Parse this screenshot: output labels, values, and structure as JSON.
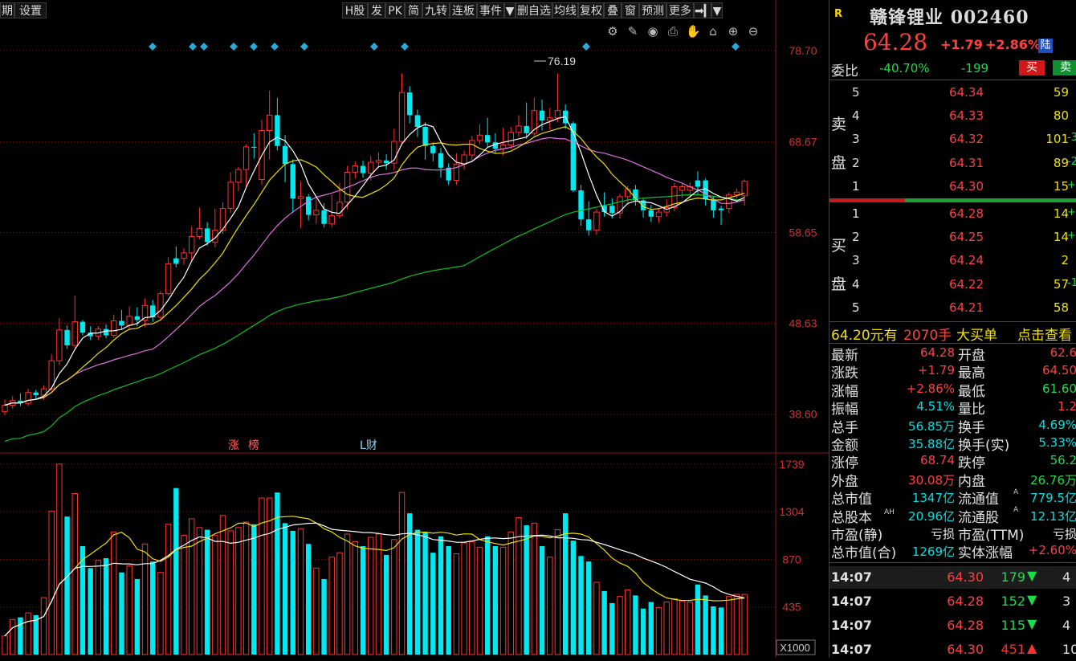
{
  "toolbar": {
    "left_items": [
      "期",
      "设置"
    ],
    "right_items": [
      "H股",
      "发",
      "PK",
      "简",
      "九转",
      "连板",
      "事件",
      "▼",
      "删自选",
      "均线",
      "复权",
      "叠",
      "窗",
      "预测",
      "更多",
      "➡▎",
      "▼"
    ],
    "icons": [
      "settings-icon",
      "pen-icon",
      "eye-icon",
      "print-icon",
      "hand-icon",
      "lock-icon",
      "zoom-in-icon",
      "zoom-out-icon"
    ]
  },
  "price_axis": [
    "78.70",
    "68.67",
    "58.65",
    "48.63",
    "38.60"
  ],
  "volume_axis": [
    "1739",
    "1304",
    "870",
    "435",
    "X1000"
  ],
  "high_label": "76.19",
  "markers": {
    "zhang": "涨",
    "bang": "榜",
    "l_cai": "L财"
  },
  "colors": {
    "up": "#ff3030",
    "down": "#00e8f0",
    "ma5": "#ffffff",
    "ma10": "#f0e000",
    "ma20": "#e070e0",
    "ma60": "#10c020",
    "grid": "#7a1010",
    "diamond": "#2aa8d8"
  },
  "stock": {
    "badge": "R",
    "name": "赣锋锂业",
    "code": "002460",
    "price": "64.28",
    "change": "+1.79",
    "change_pct": "+2.86%",
    "exchange": "陆"
  },
  "ratio": {
    "label": "委比",
    "pct": "-40.70%",
    "diff": "-199",
    "buy_btn": "买",
    "sell_btn": "卖"
  },
  "sell_side_label": [
    "卖",
    "盘"
  ],
  "buy_side_label": [
    "买",
    "盘"
  ],
  "sell_levels": [
    {
      "n": "5",
      "price": "64.34",
      "vol": "59",
      "chg": ""
    },
    {
      "n": "4",
      "price": "64.33",
      "vol": "80",
      "chg": ""
    },
    {
      "n": "3",
      "price": "64.32",
      "vol": "101",
      "chg": "-3"
    },
    {
      "n": "2",
      "price": "64.31",
      "vol": "89",
      "chg": "-2"
    },
    {
      "n": "1",
      "price": "64.30",
      "vol": "15",
      "chg": "+"
    }
  ],
  "buy_levels": [
    {
      "n": "1",
      "price": "64.28",
      "vol": "14",
      "chg": "+"
    },
    {
      "n": "2",
      "price": "64.25",
      "vol": "14",
      "chg": "+"
    },
    {
      "n": "3",
      "price": "64.24",
      "vol": "2",
      "chg": ""
    },
    {
      "n": "4",
      "price": "64.22",
      "vol": "57",
      "chg": "-1"
    },
    {
      "n": "5",
      "price": "64.21",
      "vol": "58",
      "chg": ""
    }
  ],
  "big_order": {
    "price": "64.20元有",
    "qty": "2070手",
    "label": "大买单",
    "link": "点击查看"
  },
  "stats": [
    {
      "l1": "最新",
      "v1": "64.28",
      "c1": "red",
      "l2": "开盘",
      "v2": "62.6",
      "c2": "red"
    },
    {
      "l1": "涨跌",
      "v1": "+1.79",
      "c1": "red",
      "l2": "最高",
      "v2": "64.50",
      "c2": "red"
    },
    {
      "l1": "涨幅",
      "v1": "+2.86%",
      "c1": "red",
      "l2": "最低",
      "v2": "61.60",
      "c2": "green"
    },
    {
      "l1": "振幅",
      "v1": "4.51%",
      "c1": "cyan",
      "l2": "量比",
      "v2": "1.2",
      "c2": "red"
    },
    {
      "l1": "总手",
      "v1": "56.85万",
      "c1": "cyan",
      "l2": "换手",
      "v2": "4.69%",
      "c2": "cyan"
    },
    {
      "l1": "金额",
      "v1": "35.88亿",
      "c1": "cyan",
      "l2": "换手(实)",
      "v2": "5.33%",
      "c2": "cyan"
    },
    {
      "l1": "涨停",
      "v1": "68.74",
      "c1": "red",
      "l2": "跌停",
      "v2": "56.2",
      "c2": "green"
    },
    {
      "l1": "外盘",
      "v1": "30.08万",
      "c1": "red",
      "l2": "内盘",
      "v2": "26.76万",
      "c2": "green"
    },
    {
      "l1": "总市值",
      "v1": "1347亿",
      "c1": "cyan",
      "l2": "流通值",
      "v2": "779.5亿",
      "c2": "cyan"
    },
    {
      "l1": "总股本",
      "v1": "20.96亿",
      "c1": "cyan",
      "l2": "流通股",
      "v2": "12.13亿",
      "c2": "cyan"
    },
    {
      "l1": "市盈(静)",
      "v1": "亏损",
      "c1": "white",
      "l2": "市盈(TTM)",
      "v2": "亏损",
      "c2": "white"
    },
    {
      "l1": "总市值(合)",
      "v1": "1269亿",
      "c1": "cyan",
      "l2": "实体涨幅",
      "v2": "+2.60%",
      "c2": "red"
    }
  ],
  "ah_tag": "AH",
  "a_tag": "A",
  "ticks": [
    {
      "time": "14:07",
      "price": "64.30",
      "vol": "179",
      "dir": "down",
      "extra": "4"
    },
    {
      "time": "14:07",
      "price": "64.28",
      "vol": "152",
      "dir": "down",
      "extra": "3"
    },
    {
      "time": "14:07",
      "price": "64.28",
      "vol": "115",
      "dir": "down",
      "extra": "4"
    },
    {
      "time": "14:07",
      "price": "64.30",
      "vol": "451",
      "dir": "up",
      "extra": "10"
    }
  ],
  "chart_data": {
    "type": "candlestick",
    "price_range": [
      34.5,
      82.0
    ],
    "volume_max": 1739,
    "candles": [
      [
        38.9,
        39.6,
        38.5,
        40.2,
        1.7,
        1
      ],
      [
        39.6,
        40.1,
        39.2,
        40.6,
        3.2,
        1
      ],
      [
        40.1,
        39.8,
        39.5,
        40.9,
        3.4,
        0
      ],
      [
        39.8,
        41.0,
        39.5,
        41.4,
        3.8,
        1
      ],
      [
        41.0,
        40.7,
        40.3,
        41.3,
        3.6,
        0
      ],
      [
        40.7,
        41.4,
        40.2,
        41.8,
        5.2,
        1
      ],
      [
        41.4,
        44.5,
        41.2,
        45.2,
        13.1,
        1
      ],
      [
        44.5,
        47.9,
        44.0,
        49.2,
        17.4,
        1
      ],
      [
        47.9,
        46.2,
        45.8,
        48.4,
        12.6,
        0
      ],
      [
        46.2,
        48.8,
        45.9,
        51.7,
        14.7,
        1
      ],
      [
        48.8,
        47.6,
        47.3,
        49.0,
        9.9,
        0
      ],
      [
        47.6,
        47.2,
        46.8,
        48.3,
        7.9,
        0
      ],
      [
        47.2,
        48.0,
        46.8,
        48.3,
        8.6,
        1
      ],
      [
        48.0,
        47.3,
        47.0,
        48.5,
        8.8,
        0
      ],
      [
        47.3,
        48.9,
        47.0,
        49.6,
        11.2,
        1
      ],
      [
        48.9,
        48.4,
        48.0,
        50.1,
        7.5,
        0
      ],
      [
        48.4,
        49.4,
        47.9,
        50.5,
        8.1,
        1
      ],
      [
        49.4,
        49.0,
        48.3,
        50.4,
        6.9,
        0
      ],
      [
        49.0,
        50.6,
        48.2,
        51.4,
        10.1,
        1
      ],
      [
        50.6,
        49.3,
        48.8,
        51.2,
        8.5,
        0
      ],
      [
        49.3,
        51.9,
        49.0,
        52.2,
        7.5,
        1
      ],
      [
        51.9,
        55.2,
        51.7,
        55.9,
        11.9,
        1
      ],
      [
        55.2,
        55.8,
        54.8,
        57.1,
        15.2,
        0
      ],
      [
        55.8,
        56.4,
        55.1,
        56.9,
        10.9,
        1
      ],
      [
        56.4,
        58.2,
        55.5,
        59.3,
        12.4,
        1
      ],
      [
        58.2,
        59.1,
        57.9,
        61.4,
        11.6,
        1
      ],
      [
        59.1,
        57.6,
        57.2,
        59.8,
        11.4,
        0
      ],
      [
        57.6,
        58.9,
        57.0,
        61.3,
        10.9,
        1
      ],
      [
        58.9,
        61.3,
        58.5,
        62.0,
        12.7,
        1
      ],
      [
        61.3,
        64.2,
        60.8,
        65.3,
        11.3,
        1
      ],
      [
        64.2,
        65.6,
        63.2,
        65.9,
        11.6,
        1
      ],
      [
        65.6,
        68.1,
        63.6,
        68.4,
        12.1,
        1
      ],
      [
        68.1,
        68.0,
        66.8,
        69.6,
        11.9,
        0
      ],
      [
        64.5,
        69.9,
        63.9,
        71.1,
        14.3,
        1
      ],
      [
        69.9,
        71.6,
        66.7,
        74.3,
        14.3,
        1
      ],
      [
        71.6,
        68.2,
        67.7,
        73.5,
        14.8,
        0
      ],
      [
        68.2,
        66.2,
        64.2,
        69.4,
        12.0,
        0
      ],
      [
        66.2,
        62.4,
        60.8,
        66.7,
        11.3,
        0
      ],
      [
        62.4,
        62.6,
        59.1,
        64.3,
        11.5,
        1
      ],
      [
        62.6,
        60.6,
        60.0,
        62.9,
        10.1,
        0
      ],
      [
        60.6,
        61.1,
        59.6,
        62.3,
        7.9,
        1
      ],
      [
        61.1,
        59.6,
        59.2,
        61.9,
        6.9,
        0
      ],
      [
        59.6,
        60.5,
        59.2,
        62.8,
        8.9,
        1
      ],
      [
        60.5,
        62.0,
        60.2,
        64.1,
        9.3,
        1
      ],
      [
        62.0,
        65.3,
        61.2,
        66.0,
        11.0,
        1
      ],
      [
        65.3,
        66.0,
        64.6,
        66.5,
        10.3,
        1
      ],
      [
        66.0,
        65.2,
        64.7,
        66.6,
        9.9,
        0
      ],
      [
        65.2,
        66.4,
        64.4,
        67.1,
        10.7,
        1
      ],
      [
        66.4,
        66.6,
        65.8,
        67.5,
        11.0,
        1
      ],
      [
        66.6,
        66.3,
        65.6,
        67.3,
        9.1,
        0
      ],
      [
        66.3,
        68.7,
        65.5,
        70.1,
        10.5,
        1
      ],
      [
        68.7,
        74.1,
        68.3,
        76.2,
        14.8,
        1
      ],
      [
        74.1,
        71.6,
        70.7,
        74.8,
        12.9,
        0
      ],
      [
        71.6,
        70.3,
        69.2,
        72.2,
        11.4,
        0
      ],
      [
        70.3,
        68.2,
        66.7,
        70.8,
        11.2,
        0
      ],
      [
        68.2,
        67.4,
        66.5,
        68.6,
        9.3,
        0
      ],
      [
        67.4,
        65.8,
        64.7,
        68.0,
        10.8,
        0
      ],
      [
        65.8,
        64.4,
        63.9,
        66.3,
        9.9,
        0
      ],
      [
        64.4,
        66.2,
        63.9,
        67.4,
        9.2,
        1
      ],
      [
        66.2,
        67.2,
        65.6,
        67.7,
        10.2,
        1
      ],
      [
        67.2,
        68.8,
        66.7,
        69.3,
        10.3,
        1
      ],
      [
        68.8,
        69.4,
        68.4,
        70.6,
        9.8,
        1
      ],
      [
        69.4,
        68.6,
        68.1,
        71.3,
        10.8,
        0
      ],
      [
        68.6,
        67.9,
        67.4,
        69.6,
        9.9,
        0
      ],
      [
        67.9,
        68.3,
        67.2,
        70.2,
        9.8,
        1
      ],
      [
        68.3,
        69.7,
        67.9,
        70.3,
        11.2,
        1
      ],
      [
        69.7,
        70.4,
        69.2,
        71.6,
        12.5,
        1
      ],
      [
        70.4,
        69.6,
        69.0,
        73.0,
        11.8,
        0
      ],
      [
        69.6,
        72.1,
        69.3,
        73.5,
        12.0,
        1
      ],
      [
        72.1,
        71.0,
        69.9,
        73.3,
        9.9,
        0
      ],
      [
        71.0,
        71.3,
        70.0,
        72.4,
        8.9,
        1
      ],
      [
        71.3,
        72.1,
        70.8,
        76.2,
        11.4,
        1
      ],
      [
        72.1,
        70.7,
        70.1,
        72.8,
        12.9,
        0
      ],
      [
        70.7,
        63.3,
        63.1,
        70.9,
        10.4,
        0
      ],
      [
        63.3,
        60.1,
        59.4,
        63.9,
        9.0,
        0
      ],
      [
        60.1,
        58.9,
        58.3,
        62.1,
        8.5,
        0
      ],
      [
        58.9,
        60.9,
        58.4,
        61.3,
        6.6,
        1
      ],
      [
        60.9,
        61.6,
        60.4,
        63.1,
        5.8,
        0
      ],
      [
        61.6,
        60.8,
        60.2,
        62.4,
        4.7,
        0
      ],
      [
        60.8,
        62.6,
        60.2,
        62.9,
        5.3,
        1
      ],
      [
        62.6,
        63.4,
        62.0,
        63.8,
        5.9,
        1
      ],
      [
        63.4,
        62.2,
        61.6,
        63.9,
        5.4,
        0
      ],
      [
        62.2,
        61.1,
        60.3,
        62.4,
        4.2,
        0
      ],
      [
        61.1,
        60.4,
        59.8,
        61.7,
        4.8,
        0
      ],
      [
        60.4,
        60.9,
        59.7,
        61.3,
        4.3,
        1
      ],
      [
        60.9,
        61.4,
        60.4,
        62.3,
        4.8,
        1
      ],
      [
        61.4,
        63.7,
        61.0,
        64.1,
        5.1,
        1
      ],
      [
        63.7,
        63.3,
        62.5,
        64.0,
        4.9,
        1
      ],
      [
        63.3,
        63.7,
        62.5,
        64.2,
        4.8,
        1
      ],
      [
        63.7,
        64.4,
        62.9,
        65.4,
        6.4,
        0
      ],
      [
        64.4,
        62.3,
        61.6,
        64.6,
        5.4,
        0
      ],
      [
        62.3,
        61.1,
        60.3,
        62.6,
        4.4,
        0
      ],
      [
        61.1,
        61.3,
        59.5,
        61.6,
        4.3,
        0
      ],
      [
        61.3,
        62.8,
        60.8,
        63.1,
        5.3,
        1
      ],
      [
        62.8,
        63.1,
        62.4,
        63.5,
        5.5,
        1
      ],
      [
        62.7,
        64.3,
        61.6,
        64.5,
        5.5,
        1
      ]
    ]
  }
}
